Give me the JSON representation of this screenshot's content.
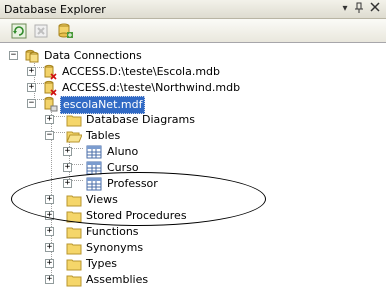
{
  "window": {
    "title": "Database Explorer",
    "pin_glyph": "▾ ⊥",
    "close_glyph": "×"
  },
  "toolbar": {
    "refresh_icon": "refresh-icon",
    "stop_icon": "stop-icon",
    "connect_icon": "connect-database-icon"
  },
  "tree": {
    "root": {
      "label": "Data Connections"
    },
    "connections": [
      {
        "label": "ACCESS.D:\\teste\\Escola.mdb",
        "state": "broken"
      },
      {
        "label": "ACCESS.d:\\teste\\Northwind.mdb",
        "state": "broken"
      },
      {
        "label": "escolaNet.mdf",
        "state": "selected"
      }
    ],
    "folders": [
      {
        "label": "Database Diagrams"
      },
      {
        "label": "Tables"
      },
      {
        "label": "Views"
      },
      {
        "label": "Stored Procedures"
      },
      {
        "label": "Functions"
      },
      {
        "label": "Synonyms"
      },
      {
        "label": "Types"
      },
      {
        "label": "Assemblies"
      }
    ],
    "tables": [
      {
        "label": "Aluno"
      },
      {
        "label": "Curso"
      },
      {
        "label": "Professor"
      }
    ]
  },
  "colors": {
    "selection": "#316ac5",
    "folder": "#f5d66a",
    "annotation": "#000000"
  }
}
